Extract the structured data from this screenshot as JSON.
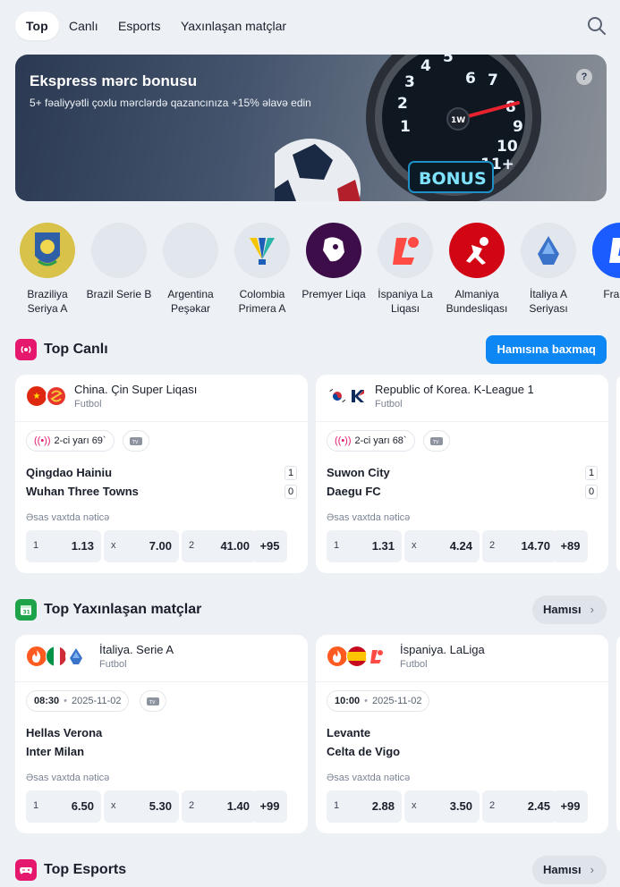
{
  "nav": {
    "tabs": [
      "Top",
      "Canlı",
      "Esports",
      "Yaxınlaşan matçlar"
    ],
    "active": 0
  },
  "banner": {
    "title": "Ekspress mərc bonusu",
    "subtitle": "5+ fəaliyyətli çoxlu mərclərdə qazancınıza +15% əlavə edin",
    "help": "?",
    "art_text": "BONUS",
    "gauge_numbers": [
      "1",
      "2",
      "3",
      "4",
      "5",
      "6",
      "7",
      "8",
      "9",
      "10",
      "11+"
    ],
    "gauge_brand": "1W"
  },
  "leagues": [
    {
      "name": "Braziliya Seriya A"
    },
    {
      "name": "Brazil Serie B"
    },
    {
      "name": "Argentina Peşəkar"
    },
    {
      "name": "Colombia Primera A"
    },
    {
      "name": "Premyer Liqa"
    },
    {
      "name": "İspaniya La Liqası"
    },
    {
      "name": "Almaniya Bundesliqası"
    },
    {
      "name": "İtaliya A Seriyası"
    },
    {
      "name": "Fransa"
    }
  ],
  "top_live": {
    "title": "Top Canlı",
    "all_button": "Hamısına baxmaq",
    "result_label": "Əsas vaxtda nəticə",
    "cards": [
      {
        "league": "China. Çin Super Liqası",
        "sport": "Futbol",
        "status": "2-ci yarı 69`",
        "team1": "Qingdao Hainiu",
        "score1": "1",
        "team2": "Wuhan Three Towns",
        "score2": "0",
        "odds": [
          {
            "k": "1",
            "v": "1.13"
          },
          {
            "k": "x",
            "v": "7.00"
          },
          {
            "k": "2",
            "v": "41.00"
          }
        ],
        "more": "+95"
      },
      {
        "league": "Republic of Korea. K-League 1",
        "sport": "Futbol",
        "status": "2-ci yarı 68`",
        "team1": "Suwon City",
        "score1": "1",
        "team2": "Daegu FC",
        "score2": "0",
        "odds": [
          {
            "k": "1",
            "v": "1.31"
          },
          {
            "k": "x",
            "v": "4.24"
          },
          {
            "k": "2",
            "v": "14.70"
          }
        ],
        "more": "+89"
      }
    ]
  },
  "top_upcoming": {
    "title": "Top Yaxınlaşan matçlar",
    "calendar_day": "31",
    "all_button": "Hamısı",
    "result_label": "Əsas vaxtda nəticə",
    "cards": [
      {
        "league": "İtaliya. Serie A",
        "sport": "Futbol",
        "time": "08:30",
        "date": "2025-11-02",
        "team1": "Hellas Verona",
        "team2": "Inter Milan",
        "odds": [
          {
            "k": "1",
            "v": "6.50"
          },
          {
            "k": "x",
            "v": "5.30"
          },
          {
            "k": "2",
            "v": "1.40"
          }
        ],
        "more": "+99"
      },
      {
        "league": "İspaniya. LaLiga",
        "sport": "Futbol",
        "time": "10:00",
        "date": "2025-11-02",
        "team1": "Levante",
        "team2": "Celta de Vigo",
        "odds": [
          {
            "k": "1",
            "v": "2.88"
          },
          {
            "k": "x",
            "v": "3.50"
          },
          {
            "k": "2",
            "v": "2.45"
          }
        ],
        "more": "+99"
      }
    ]
  },
  "top_esports": {
    "title": "Top Esports",
    "all_button": "Hamısı"
  },
  "colors": {
    "accent_blue": "#0d87f3",
    "live_pink": "#e6186d",
    "calendar_green": "#1fa34a",
    "background": "#edf0f5"
  }
}
